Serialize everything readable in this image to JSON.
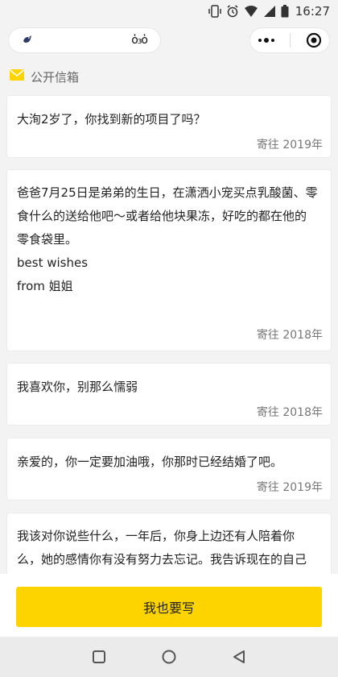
{
  "status_bar": {
    "time": "16:27"
  },
  "header": {
    "left_pill_text": "ὁ₃ὁ"
  },
  "section": {
    "title": "公开信箱"
  },
  "letters": [
    {
      "lines": [
        "大洵2岁了，你找到新的项目了吗？"
      ],
      "date": "寄往 2019年"
    },
    {
      "lines": [
        "爸爸7月25日是弟弟的生日，在潇洒小宠买点乳酸菌、零",
        "食什么的送给他吧～或者给他块果冻，好吃的都在他的",
        "零食袋里。",
        "best wishes",
        "from 姐姐"
      ],
      "date": "寄往 2018年"
    },
    {
      "lines": [
        "我喜欢你，别那么懦弱"
      ],
      "date": "寄往 2018年"
    },
    {
      "lines": [
        "亲爱的，你一定要加油哦，你那时已经结婚了吧。"
      ],
      "date": "寄往 2019年"
    },
    {
      "lines": [
        "我该对你说些什么，一年后，你身上边还有人陪着你",
        "么，她的感情你有没有努力去忘记。我告诉现在的自己"
      ],
      "date": ""
    }
  ],
  "action": {
    "write_label": "我也要写"
  },
  "colors": {
    "accent": "#fdd400",
    "background": "#f3f3f3"
  },
  "icons": {
    "status": [
      "vibrate-icon",
      "alarm-icon",
      "wifi-icon",
      "signal-icon",
      "battery-icon"
    ],
    "header": [
      "bird-icon",
      "more-dots-icon",
      "target-icon"
    ],
    "section": "envelope-icon",
    "nav": [
      "square-icon",
      "circle-icon",
      "triangle-back-icon"
    ]
  }
}
